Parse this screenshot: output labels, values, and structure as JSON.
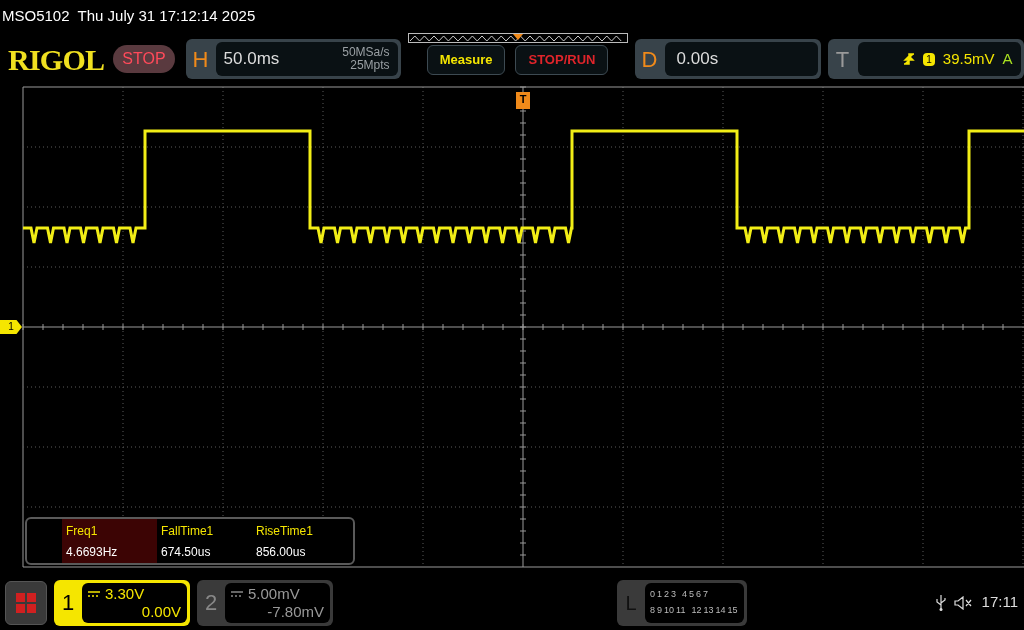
{
  "title": "MSO5102  Thu July 31 17:12:14 2025",
  "brand": "RIGOL",
  "run_state": "STOP",
  "horizontal": {
    "label": "H",
    "timebase": "50.0ms",
    "sample_rate": "50MSa/s",
    "memory_depth": "25Mpts"
  },
  "buttons": [
    {
      "kind": "measure",
      "label": "Measure"
    },
    {
      "kind": "run",
      "label": "STOP/RUN"
    }
  ],
  "delay": {
    "label": "D",
    "value": "0.00s"
  },
  "trigger": {
    "label": "T",
    "source": "1",
    "threshold": "39.5mV",
    "mode": "A"
  },
  "trigger_marker": "T",
  "channel_marker": "1",
  "measurements": [
    {
      "name": "Freq1",
      "value": "4.6693Hz",
      "selected": true
    },
    {
      "name": "FallTime1",
      "value": "674.50us",
      "selected": false
    },
    {
      "name": "RiseTime1",
      "value": "856.00us",
      "selected": false
    }
  ],
  "channels": [
    {
      "number": "1",
      "scale": "3.30V",
      "offset": "0.00V",
      "on": true
    },
    {
      "number": "2",
      "scale": "5.00mV",
      "offset": "-7.80mV",
      "on": false
    }
  ],
  "logic": {
    "label": "L",
    "row1": [
      "0",
      "1",
      "2",
      "3",
      "4",
      "5",
      "6",
      "7"
    ],
    "row2": [
      "8",
      "9",
      "10",
      "11",
      "12",
      "13",
      "14",
      "15"
    ]
  },
  "status": {
    "time": "17:11"
  }
}
